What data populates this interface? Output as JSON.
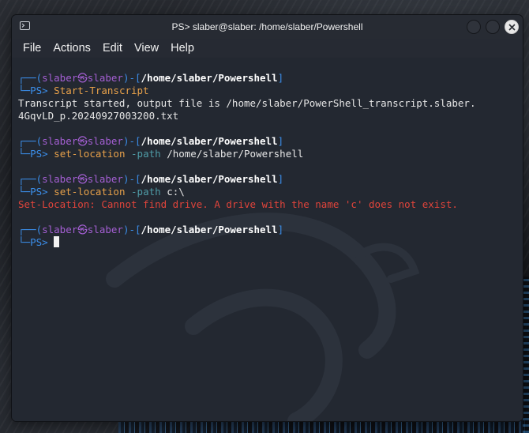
{
  "window": {
    "title": "PS> slaber@slaber: /home/slaber/Powershell"
  },
  "menu": {
    "items": [
      "File",
      "Actions",
      "Edit",
      "View",
      "Help"
    ]
  },
  "prompt": {
    "corner": "┌──",
    "open": "(",
    "user": "slaber",
    "at": "㉿",
    "host": "slaber",
    "close": ")-[",
    "path": "/home/slaber/Powershell",
    "bracket_end": "]",
    "corner2": "└─",
    "ps": "PS>"
  },
  "terminal": {
    "cmd1": "Start-Transcript",
    "out1_line1": "Transcript started, output file is /home/slaber/PowerShell_transcript.slaber.",
    "out1_line2": "4GqvLD_p.20240927003200.txt",
    "cmd2_name": "set-location",
    "cmd2_param": "-path",
    "cmd2_arg": "/home/slaber/Powershell",
    "cmd3_name": "set-location",
    "cmd3_param": "-path",
    "cmd3_arg": "c:\\",
    "err3": "Set-Location: Cannot find drive. A drive with the name 'c' does not exist."
  },
  "colors": {
    "prompt_frame": "#3b8eea",
    "user_host": "#a45fd3",
    "command": "#e8a14a",
    "parameter": "#4f9ca7",
    "error": "#e0443b",
    "background": "#232831"
  }
}
